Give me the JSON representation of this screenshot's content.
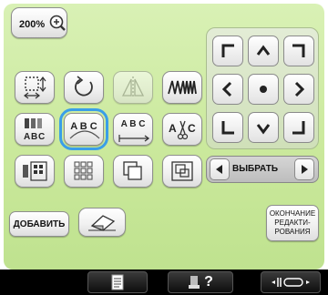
{
  "zoom": {
    "label": "200%"
  },
  "select_bar": {
    "label": "ВЫБРАТЬ"
  },
  "add_button": {
    "label": "ДОБАВИТЬ"
  },
  "finish_edit": {
    "line1": "ОКОНЧАНИЕ",
    "line2": "РЕДАКТИ-",
    "line3": "РОВАНИЯ"
  },
  "text_sample": {
    "abc": "ABC",
    "a_b_c": "A B C"
  },
  "taskbar": {
    "help": "?"
  },
  "colors": {
    "panel": "#c9e89a",
    "selection": "#3a9ee8"
  }
}
